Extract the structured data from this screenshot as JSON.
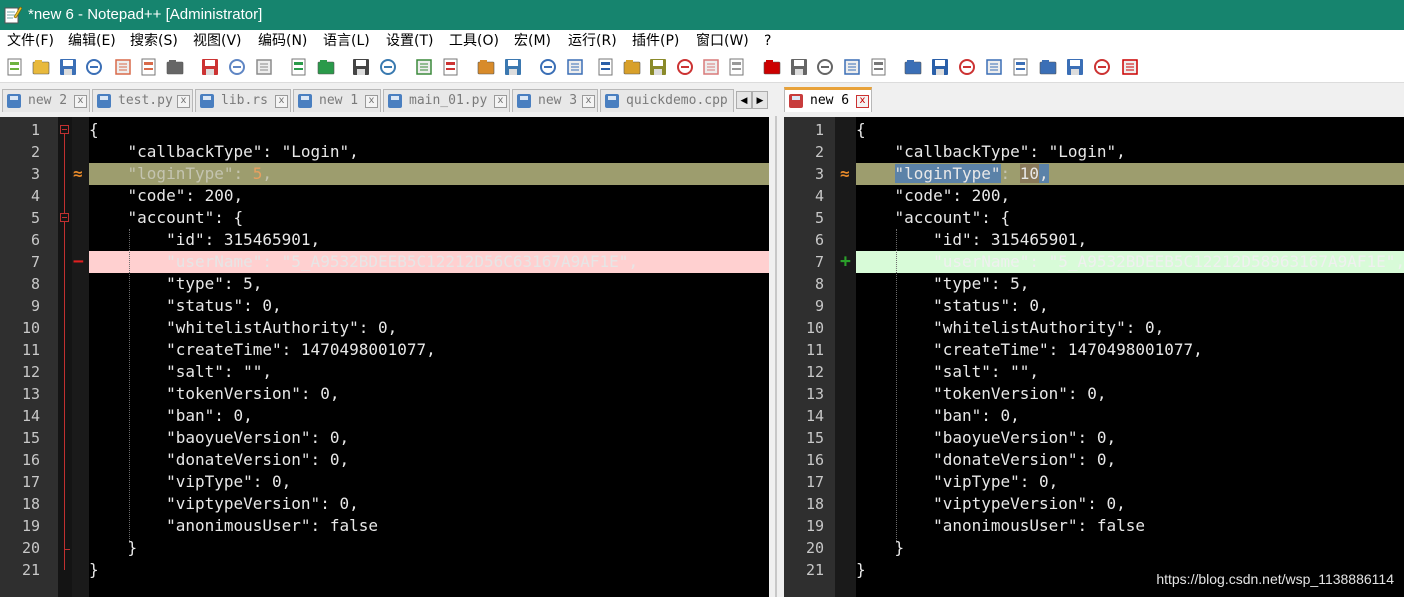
{
  "window": {
    "title": "*new 6 - Notepad++ [Administrator]",
    "accent_color": "#16846e"
  },
  "menu": [
    "文件(F)",
    "编辑(E)",
    "搜索(S)",
    "视图(V)",
    "编码(N)",
    "语言(L)",
    "设置(T)",
    "工具(O)",
    "宏(M)",
    "运行(R)",
    "插件(P)",
    "窗口(W)",
    "?"
  ],
  "toolbar_icons": [
    "new-file-icon",
    "open-file-icon",
    "save-icon",
    "save-all-icon",
    "close-icon",
    "close-all-icon",
    "print-icon",
    "cut-icon",
    "copy-icon",
    "paste-icon",
    "undo-icon",
    "redo-icon",
    "find-icon",
    "replace-icon",
    "zoom-in-icon",
    "zoom-out-icon",
    "sync-vertical-icon",
    "sync-horizontal-icon",
    "word-wrap-icon",
    "show-all-chars-icon",
    "indent-guide-icon",
    "doc-map-icon",
    "function-list-icon",
    "pdf-icon",
    "folder-icon",
    "cloud-icon",
    "record-macro-icon",
    "stop-macro-icon",
    "play-macro-icon",
    "run-macro-multiple-icon",
    "save-macro-icon",
    "compare-icon",
    "compare-options-icon",
    "compare-last-icon",
    "first-diff-icon",
    "prev-diff-icon",
    "next-diff-icon",
    "last-diff-icon",
    "nav-bar-icon",
    "spell-check-icon"
  ],
  "tabs_left": [
    {
      "label": "new 2"
    },
    {
      "label": "test.py"
    },
    {
      "label": "lib.rs"
    },
    {
      "label": "new 1"
    },
    {
      "label": "main_01.py"
    },
    {
      "label": "new 3"
    },
    {
      "label": "quickdemo.cpp"
    }
  ],
  "tabs_right": [
    {
      "label": "new 6"
    }
  ],
  "nav_buttons": {
    "prev": "◀",
    "next": "▶"
  },
  "left_editor": {
    "lines": [
      "{",
      "    \"callbackType\": \"Login\",",
      "    \"loginType\": 5,",
      "    \"code\": 200,",
      "    \"account\": {",
      "        \"id\": 315465901,",
      "        \"userName\": \"5_A9532BDEEB5C12212D56C63167A9AF1E\",",
      "        \"type\": 5,",
      "        \"status\": 0,",
      "        \"whitelistAuthority\": 0,",
      "        \"createTime\": 1470498001077,",
      "        \"salt\": \"\",",
      "        \"tokenVersion\": 0,",
      "        \"ban\": 0,",
      "        \"baoyueVersion\": 0,",
      "        \"donateVersion\": 0,",
      "        \"vipType\": 0,",
      "        \"viptypeVersion\": 0,",
      "        \"anonimousUser\": false",
      "    }",
      "}"
    ],
    "line_numbers": [
      "1",
      "2",
      "3",
      "4",
      "5",
      "6",
      "7",
      "8",
      "9",
      "10",
      "11",
      "12",
      "13",
      "14",
      "15",
      "16",
      "17",
      "18",
      "19",
      "20",
      "21"
    ]
  },
  "right_editor": {
    "lines": [
      "{",
      "    \"callbackType\": \"Login\",",
      "    \"loginType\": 10,",
      "    \"code\": 200,",
      "    \"account\": {",
      "        \"id\": 315465901,",
      "        \"userName\": \"5_A9532BDEEB5C12212D58963167A9AF1E\",",
      "        \"type\": 5,",
      "        \"status\": 0,",
      "        \"whitelistAuthority\": 0,",
      "        \"createTime\": 1470498001077,",
      "        \"salt\": \"\",",
      "        \"tokenVersion\": 0,",
      "        \"ban\": 0,",
      "        \"baoyueVersion\": 0,",
      "        \"donateVersion\": 0,",
      "        \"vipType\": 0,",
      "        \"viptypeVersion\": 0,",
      "        \"anonimousUser\": false",
      "    }",
      "}"
    ],
    "line_numbers": [
      "1",
      "2",
      "3",
      "4",
      "5",
      "6",
      "7",
      "8",
      "9",
      "10",
      "11",
      "12",
      "13",
      "14",
      "15",
      "16",
      "17",
      "18",
      "19",
      "20",
      "21"
    ]
  },
  "diff": {
    "changed_line": 3,
    "removed_line": 7,
    "added_line": 7,
    "changed_marker": "≈",
    "removed_marker": "−",
    "added_marker": "+",
    "changed_color": "#9d9d6e",
    "removed_color": "#ffd0d0",
    "added_color": "#d8fbd8"
  },
  "watermark": "https://blog.csdn.net/wsp_1138886114"
}
